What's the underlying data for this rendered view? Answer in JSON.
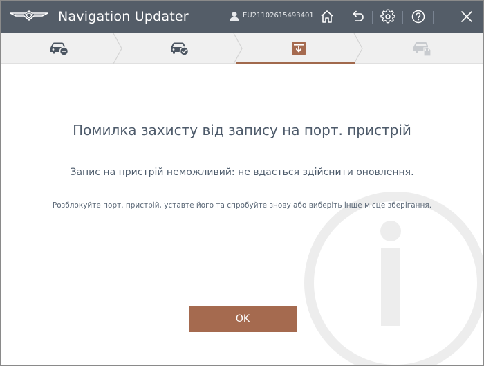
{
  "titlebar": {
    "app_title": "Navigation Updater",
    "user_id": "EU21102615493401",
    "icons": [
      "logo-icon",
      "user-icon",
      "home-icon",
      "back-icon",
      "settings-icon",
      "help-icon",
      "close-icon"
    ]
  },
  "steps": [
    {
      "icon": "car-minus-icon",
      "state": "done"
    },
    {
      "icon": "car-check-icon",
      "state": "done"
    },
    {
      "icon": "download-box-icon",
      "state": "active"
    },
    {
      "icon": "car-sd-icon",
      "state": "pending"
    }
  ],
  "dialog": {
    "heading": "Помилка захисту від запису на порт. пристрій",
    "message": "Запис на пристрій неможливий: не вдається здійснити оновлення.",
    "hint": "Розблокуйте порт. пристрій, уставте його та спробуйте знову або виберіть інше місце зберігання.",
    "ok_label": "OK",
    "watermark_icon": "info-icon"
  },
  "colors": {
    "titlebar": "#545d68",
    "accent": "#a56a4f",
    "text": "#4e5b6b"
  }
}
